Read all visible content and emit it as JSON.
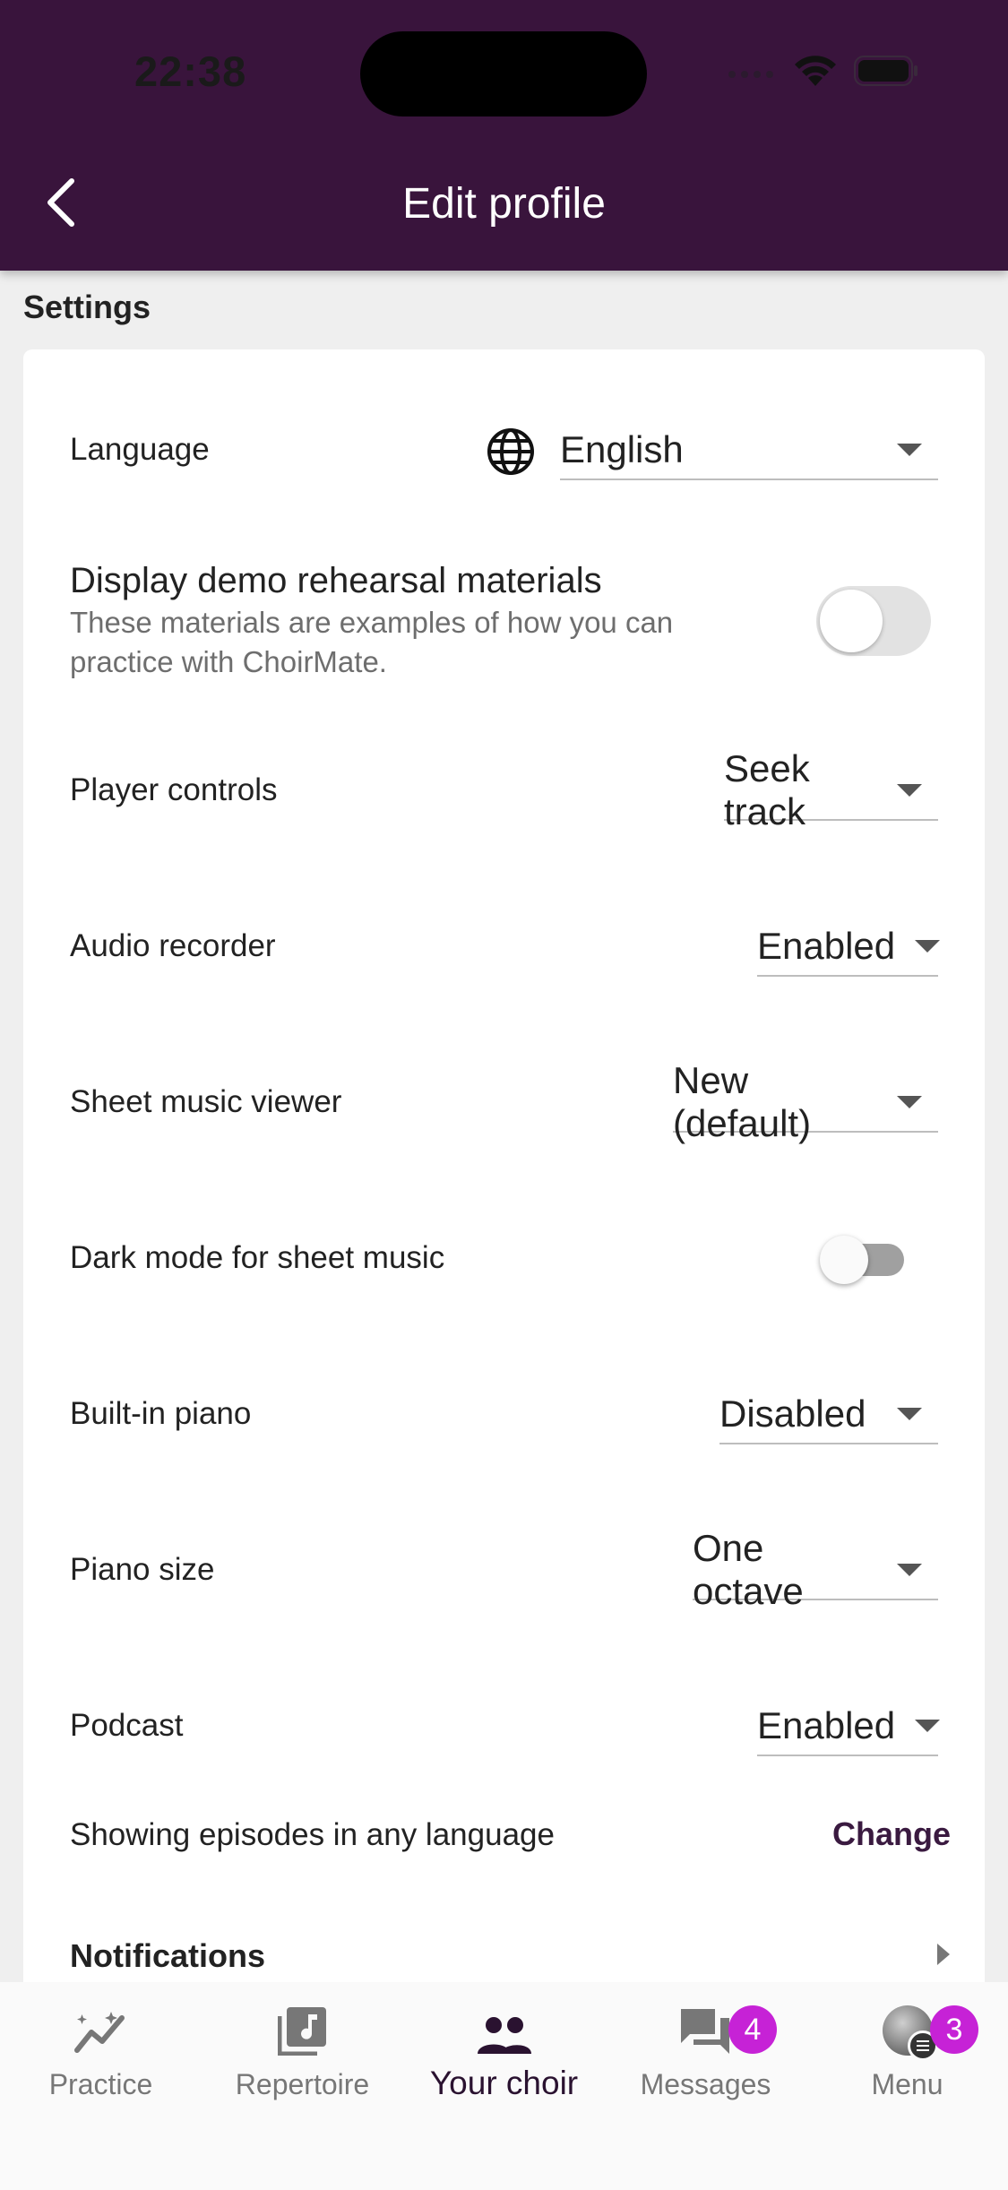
{
  "status_bar": {
    "time": "22:38"
  },
  "header": {
    "title": "Edit profile"
  },
  "settings": {
    "section_title": "Settings",
    "language": {
      "label": "Language",
      "value": "English"
    },
    "demo": {
      "title": "Display demo rehearsal materials",
      "description_line1": "These materials are examples of how you can",
      "description_line2": "practice with ChoirMate.",
      "enabled": false
    },
    "player_controls": {
      "label": "Player controls",
      "value": "Seek track"
    },
    "audio_recorder": {
      "label": "Audio recorder",
      "value": "Enabled"
    },
    "sheet_viewer": {
      "label": "Sheet music viewer",
      "value": "New (default)"
    },
    "dark_mode": {
      "label": "Dark mode for sheet music",
      "enabled": false
    },
    "piano": {
      "label": "Built-in piano",
      "value": "Disabled"
    },
    "piano_size": {
      "label": "Piano size",
      "value": "One octave"
    },
    "podcast": {
      "label": "Podcast",
      "value": "Enabled"
    },
    "episodes": {
      "label": "Showing episodes in any language",
      "action": "Change"
    },
    "notifications": {
      "label": "Notifications"
    }
  },
  "bottom_nav": {
    "items": [
      {
        "label": "Practice",
        "icon": "practice-chart-icon"
      },
      {
        "label": "Repertoire",
        "icon": "music-note-icon"
      },
      {
        "label": "Your choir",
        "icon": "people-icon",
        "active": true
      },
      {
        "label": "Messages",
        "icon": "chat-icon",
        "badge": "4"
      },
      {
        "label": "Menu",
        "icon": "avatar",
        "badge": "3"
      }
    ]
  },
  "colors": {
    "header_bg": "#39143c",
    "badge": "#c622d6",
    "accent_text": "#3a1a40"
  }
}
